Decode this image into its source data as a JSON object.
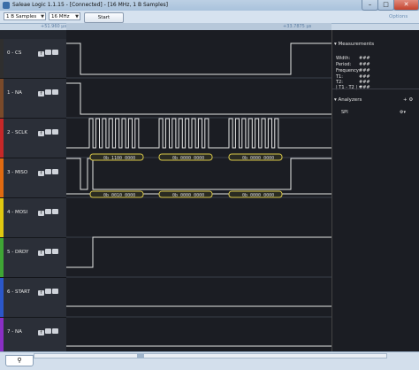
{
  "window": {
    "title": "Saleae Logic 1.1.15 - [Connected] - [16 MHz, 1 B Samples]",
    "min_glyph": "–",
    "max_glyph": "□",
    "close_glyph": "✕"
  },
  "toolbar": {
    "samples_value": "1 B Samples",
    "rate_value": "16 MHz",
    "start_label": "Start",
    "options_label": "Options"
  },
  "ruler": {
    "left_label": "+51.960 µs",
    "right_label": "+33.7875 µs"
  },
  "channels": [
    {
      "label": "0 - CS",
      "color": "#2f2f2f"
    },
    {
      "label": "1 - NA",
      "color": "#7a4a2a"
    },
    {
      "label": "2 - SCLK",
      "color": "#c62828"
    },
    {
      "label": "3 - MISO",
      "color": "#e06a10"
    },
    {
      "label": "4 - MOSI",
      "color": "#e0c810"
    },
    {
      "label": "5 - DRDY",
      "color": "#3fa535"
    },
    {
      "label": "6 - START",
      "color": "#2b57c9"
    },
    {
      "label": "7 - NA",
      "color": "#8a2fc4"
    }
  ],
  "channel_icon_glyph": "f",
  "decodes": {
    "miso": [
      "0b 1100 0000",
      "0b 0000 0000",
      "0b 0000 0000"
    ],
    "mosi": [
      "0b 0010 0000",
      "0b 0000 0000",
      "0b 0000 0000"
    ]
  },
  "measurements": {
    "header": "Measurements",
    "width_label": "Width:",
    "width_value": "###",
    "period_label": "Period:",
    "period_value": "###",
    "frequency_label": "Frequency:",
    "frequency_value": "###",
    "t1_label": "T1:",
    "t1_value": "###",
    "t2_label": "T2:",
    "t2_value": "###",
    "diff_label": "| T1 - T2 | =",
    "diff_value": "###"
  },
  "analyzers": {
    "header": "Analyzers",
    "items": [
      "SPI"
    ],
    "add_glyph": "+"
  },
  "bottom": {
    "search_glyph": "⚲"
  },
  "colors": {
    "signal": "#e6e6e6",
    "decode_border": "#d9c84a",
    "background": "#1b1d23"
  }
}
